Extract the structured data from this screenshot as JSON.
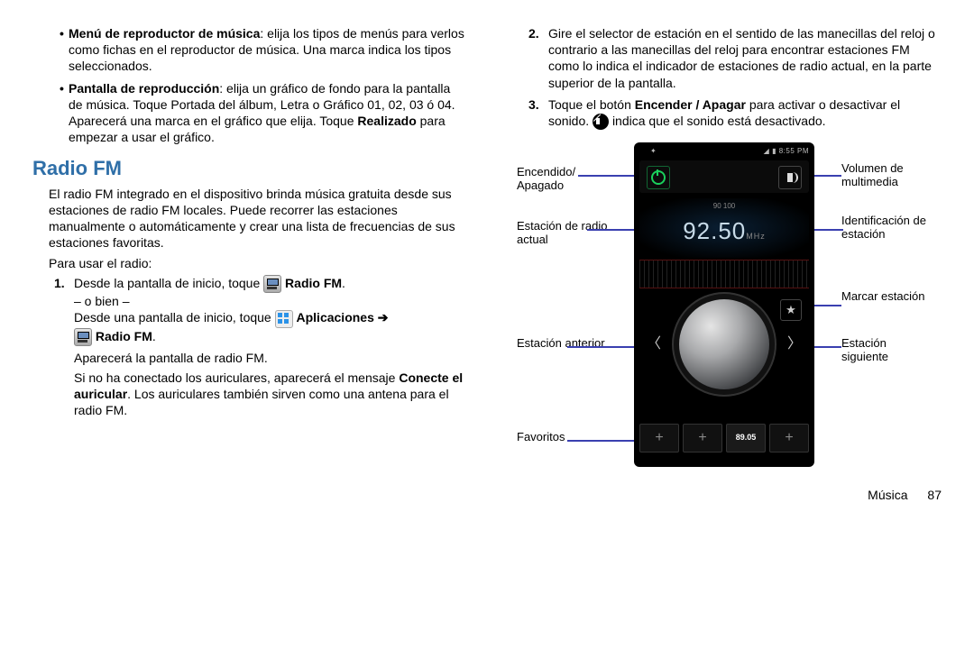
{
  "left": {
    "bullets": [
      {
        "title": "Menú de reproductor de música",
        "text": ": elija los tipos de menús para verlos como fichas en el reproductor de música. Una marca indica los tipos seleccionados."
      },
      {
        "title": "Pantalla de reproducción",
        "text": ": elija un gráfico de fondo para la pantalla de música. Toque Portada del álbum, Letra o Gráfico 01, 02, 03 ó 04. Aparecerá una marca en el gráfico que elija. Toque ",
        "bold2": "Realizado",
        "text2": " para empezar a usar el gráfico."
      }
    ],
    "heading": "Radio FM",
    "intro": "El radio FM integrado en el dispositivo brinda música gratuita desde sus estaciones de radio FM locales. Puede recorrer las estaciones manualmente o automáticamente y crear una lista de frecuencias de sus estaciones favoritas.",
    "para_use": "Para usar el radio:",
    "step1_a": "Desde la pantalla de inicio, toque ",
    "step1_b": "Radio FM",
    "step1_or": "– o bien –",
    "step1_c": "Desde una pantalla de inicio, toque ",
    "step1_d": "Aplicaciones",
    "arrow": "➔",
    "step1_e": "Radio FM",
    "step1_dot": ".",
    "appear": "Aparecerá la pantalla de radio FM.",
    "noaur_a": "Si no ha conectado los auriculares, aparecerá el mensaje ",
    "noaur_b": "Conecte el auricular",
    "noaur_c": ". Los auriculares también sirven como una antena para el radio FM."
  },
  "right": {
    "step2": "Gire el selector de estación en el sentido de las manecillas del reloj o contrario a las manecillas del reloj para encontrar estaciones FM como lo indica el indicador de estaciones de radio actual, en la parte superior de la pantalla.",
    "step3_a": "Toque el botón ",
    "step3_b": "Encender / Apagar",
    "step3_c": " para activar o desactivar el sonido. ",
    "step3_d": " indica que el sonido está desactivado.",
    "phone": {
      "time": "8:55 PM",
      "freq": "92.50",
      "mhz": "MHz",
      "ticks": "90            100",
      "fav_preset": "89.05"
    },
    "callouts": {
      "power": "Encendido/ Apagado",
      "current": "Estación de radio actual",
      "prev": "Estación anterior",
      "favs": "Favoritos",
      "vol": "Volumen de multimedia",
      "id": "Identificación de estación",
      "mark": "Marcar estación",
      "next": "Estación siguiente"
    }
  },
  "footer": {
    "section": "Música",
    "page": "87"
  }
}
